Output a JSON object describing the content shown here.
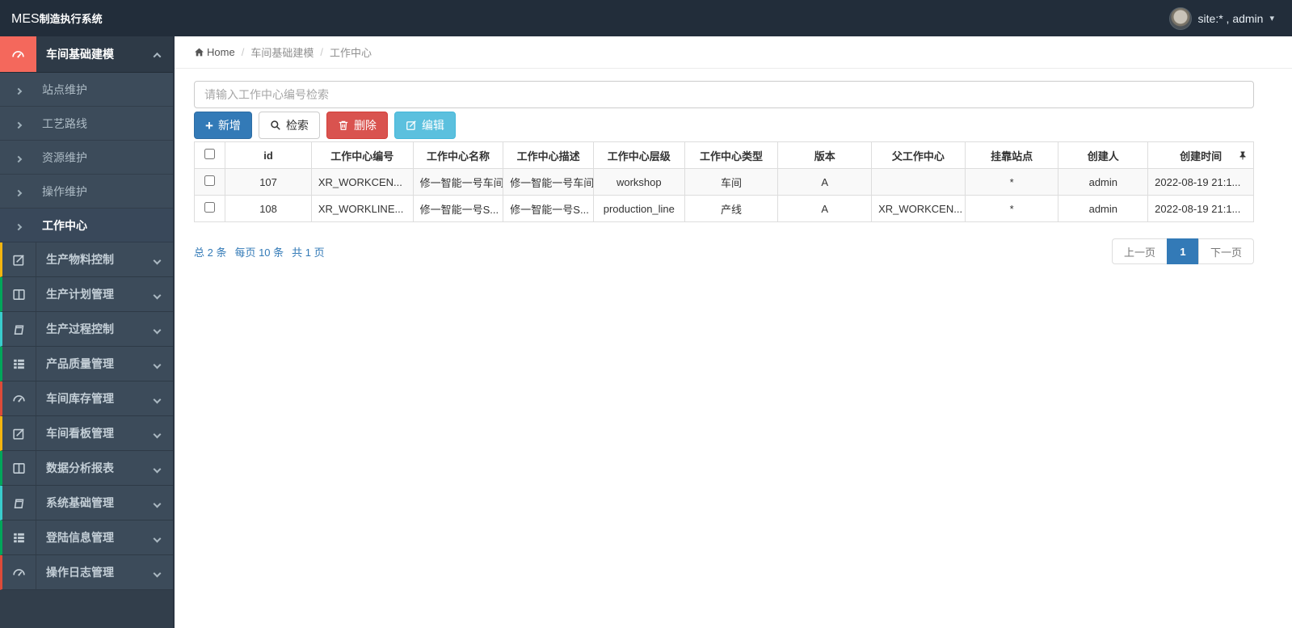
{
  "topbar": {
    "logo_bold": "MES",
    "logo_rest": "制造执行系统",
    "user_label": "site:* , admin"
  },
  "breadcrumb": {
    "home": "Home",
    "crumb1": "车间基础建模",
    "crumb2": "工作中心"
  },
  "sidebar": {
    "sections": [
      {
        "label": "车间基础建模",
        "icon": "dashboard-icon",
        "state": "expanded-active",
        "children": [
          {
            "label": "站点维护"
          },
          {
            "label": "工艺路线"
          },
          {
            "label": "资源维护"
          },
          {
            "label": "操作维护"
          },
          {
            "label": "工作中心",
            "active": true
          }
        ]
      },
      {
        "label": "生产物料控制",
        "icon": "edit-icon",
        "accent": "#f3b50f"
      },
      {
        "label": "生产计划管理",
        "icon": "columns-icon",
        "accent": "#00a65a"
      },
      {
        "label": "生产过程控制",
        "icon": "book-icon",
        "accent": "#39cccc"
      },
      {
        "label": "产品质量管理",
        "icon": "list-icon",
        "accent": "#00a65a"
      },
      {
        "label": "车间库存管理",
        "icon": "dashboard-icon",
        "accent": "#dd4b39"
      },
      {
        "label": "车间看板管理",
        "icon": "edit-icon",
        "accent": "#f3b50f"
      },
      {
        "label": "数据分析报表",
        "icon": "columns-icon",
        "accent": "#00a65a"
      },
      {
        "label": "系统基础管理",
        "icon": "book-icon",
        "accent": "#39cccc"
      },
      {
        "label": "登陆信息管理",
        "icon": "list-icon",
        "accent": "#00a65a"
      },
      {
        "label": "操作日志管理",
        "icon": "dashboard-icon",
        "accent": "#dd4b39"
      }
    ]
  },
  "search": {
    "placeholder": "请输入工作中心编号检索",
    "value": ""
  },
  "toolbar": {
    "add_label": "新增",
    "search_label": "检索",
    "delete_label": "删除",
    "edit_label": "编辑"
  },
  "table": {
    "columns": [
      "id",
      "工作中心编号",
      "工作中心名称",
      "工作中心描述",
      "工作中心层级",
      "工作中心类型",
      "版本",
      "父工作中心",
      "挂靠站点",
      "创建人",
      "创建时间"
    ],
    "rows": [
      [
        "107",
        "XR_WORKCEN...",
        "修一智能一号车间",
        "修一智能一号车间",
        "workshop",
        "车间",
        "A",
        "",
        "*",
        "admin",
        "2022-08-19 21:1..."
      ],
      [
        "108",
        "XR_WORKLINE...",
        "修一智能一号S...",
        "修一智能一号S...",
        "production_line",
        "产线",
        "A",
        "XR_WORKCEN...",
        "*",
        "admin",
        "2022-08-19 21:1..."
      ]
    ]
  },
  "pagination": {
    "summary_total": "总 2 条",
    "summary_per_page": "每页 10 条",
    "summary_pages": "共 1 页",
    "prev_label": "上一页",
    "current_page": "1",
    "next_label": "下一页"
  },
  "colors": {
    "topbar_bg": "#222d3a",
    "sidebar_bg": "#3c4b5a",
    "active_icon_bg": "#f4685c",
    "primary": "#337ab7",
    "danger": "#d9534f",
    "info": "#5bc0de",
    "link_blue": "#337ab7",
    "table_border": "#dddddd",
    "stripe_row": "#f9f9f9"
  }
}
